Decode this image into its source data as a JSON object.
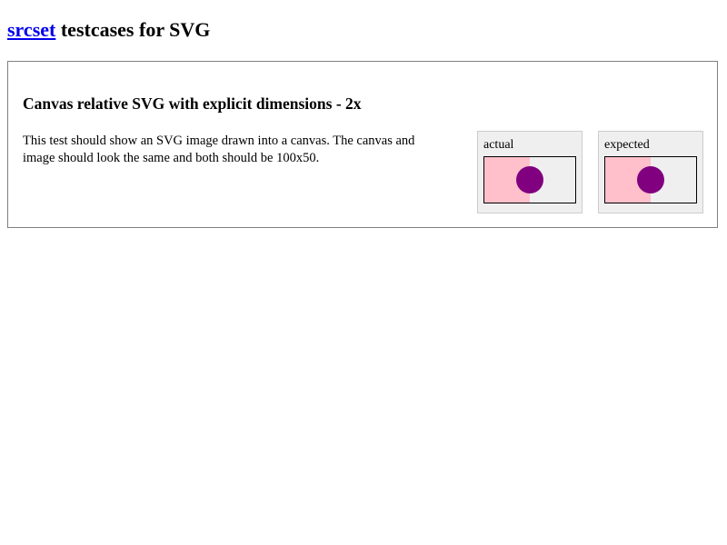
{
  "header": {
    "link_text": "srcset",
    "title_rest": " testcases for SVG"
  },
  "testcase": {
    "title": "Canvas relative SVG with explicit dimensions - 2x",
    "description": "This test should show an SVG image drawn into a canvas. The canvas and image should look the same and both should be 100x50.",
    "panels": [
      {
        "label": "actual"
      },
      {
        "label": "expected"
      }
    ]
  },
  "colors": {
    "link": "#0000ee",
    "panel_bg": "#efefef",
    "left_half": "#ffc0cb",
    "circle": "#800080",
    "frame_border": "#000000",
    "box_border": "#808080"
  }
}
